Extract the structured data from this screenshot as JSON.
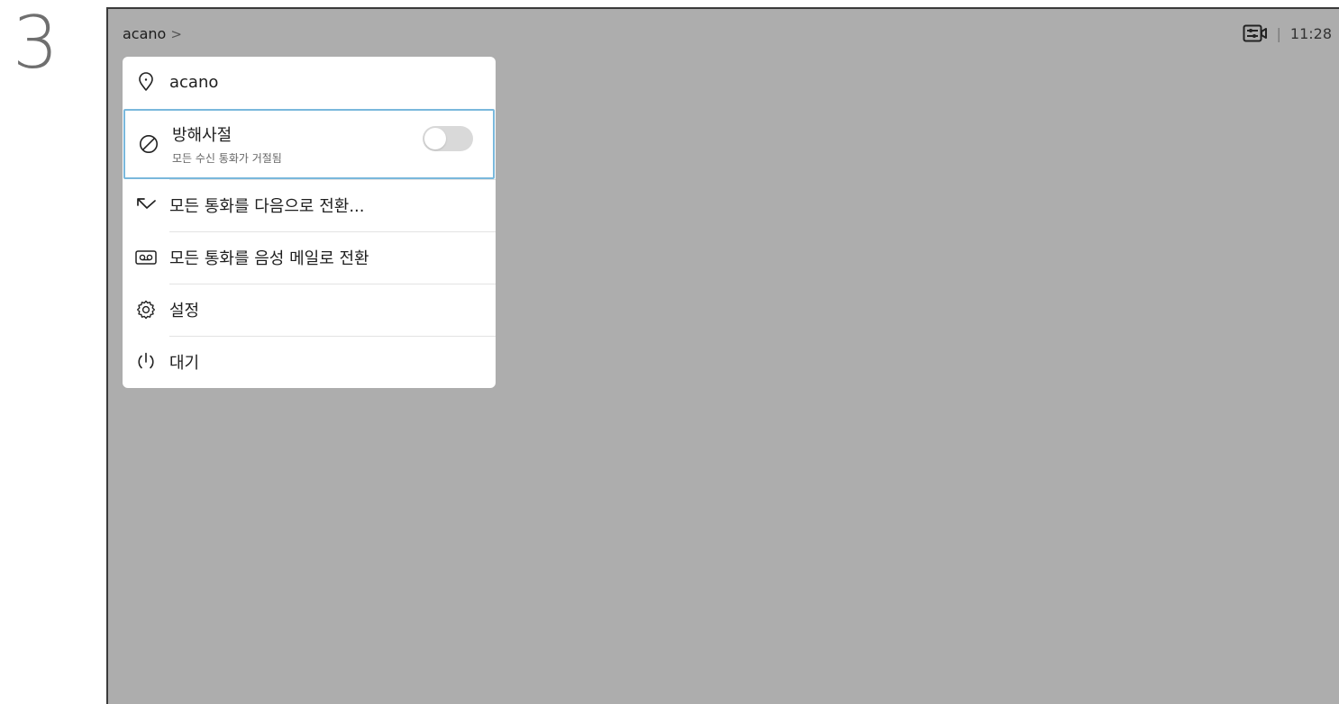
{
  "step": "3",
  "header": {
    "breadcrumb": "acano",
    "chevron": ">",
    "separator": "|",
    "time": "11:28",
    "status_icon": "camera-settings-icon"
  },
  "menu": {
    "location": {
      "label": "acano",
      "icon": "location-pin-icon"
    },
    "do_not_disturb": {
      "label": "방해사절",
      "sublabel": "모든 수신 통화가 거절됨",
      "icon": "block-icon",
      "enabled": false
    },
    "items": [
      {
        "label": "모든 통화를 다음으로 전환...",
        "icon": "forward-arrow-icon"
      },
      {
        "label": "모든 통화를 음성 메일로 전환",
        "icon": "voicemail-icon"
      },
      {
        "label": "설정",
        "icon": "gear-icon"
      },
      {
        "label": "대기",
        "icon": "power-icon"
      }
    ]
  },
  "colors": {
    "screen_background": "#adadad",
    "focus_border": "#7ab8dc",
    "toggle_off": "#d9d9d9"
  }
}
